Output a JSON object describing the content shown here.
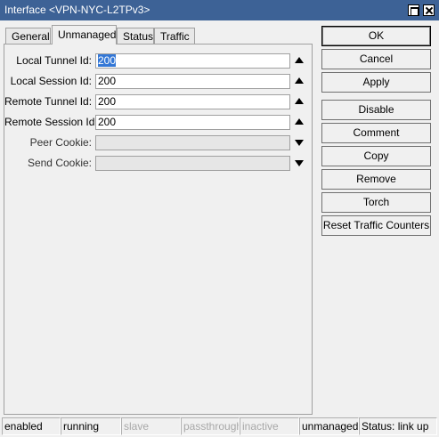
{
  "window": {
    "title": "Interface <VPN-NYC-L2TPv3>"
  },
  "tabs": [
    {
      "label": "General"
    },
    {
      "label": "Unmanaged"
    },
    {
      "label": "Status"
    },
    {
      "label": "Traffic"
    }
  ],
  "form": {
    "local_tunnel_id": {
      "label": "Local Tunnel Id:",
      "value": "200"
    },
    "local_session_id": {
      "label": "Local Session Id:",
      "value": "200"
    },
    "remote_tunnel_id": {
      "label": "Remote Tunnel Id:",
      "value": "200"
    },
    "remote_session_id": {
      "label": "Remote Session Id:",
      "value": "200"
    },
    "peer_cookie": {
      "label": "Peer Cookie:",
      "value": ""
    },
    "send_cookie": {
      "label": "Send Cookie:",
      "value": ""
    }
  },
  "buttons": {
    "ok": "OK",
    "cancel": "Cancel",
    "apply": "Apply",
    "disable": "Disable",
    "comment": "Comment",
    "copy": "Copy",
    "remove": "Remove",
    "torch": "Torch",
    "reset_traffic": "Reset Traffic Counters"
  },
  "status_bar": {
    "enabled": "enabled",
    "running": "running",
    "slave": "slave",
    "passthrough": "passthrough",
    "inactive": "inactive",
    "unmanaged": "unmanaged",
    "status": "Status: link up"
  },
  "colors": {
    "titlebar": "#3d6296",
    "selection": "#3377d6"
  }
}
